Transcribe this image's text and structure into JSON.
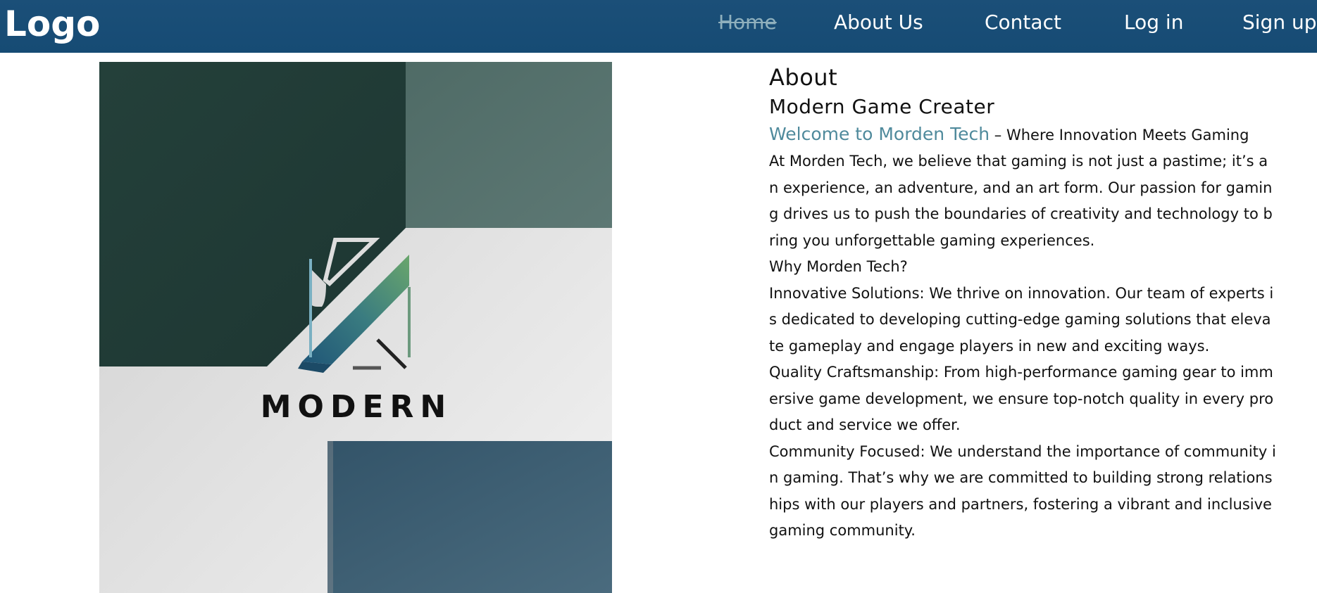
{
  "header": {
    "logo": "Logo",
    "nav": [
      {
        "label": "Home",
        "active": true
      },
      {
        "label": "About Us",
        "active": false
      },
      {
        "label": "Contact",
        "active": false
      },
      {
        "label": "Log in",
        "active": false
      },
      {
        "label": "Sign up",
        "active": false
      }
    ]
  },
  "hero": {
    "logo_text": "MODERN"
  },
  "about": {
    "title": "About",
    "subtitle": "Modern Game Creater",
    "welcome_accent": "Welcome to Morden Tech",
    "welcome_rest": " – Where Innovation Meets Gaming",
    "paragraphs": [
      "At Morden Tech, we believe that gaming is not just a pastime; it’s an experience, an adventure, and an art form. Our passion for gaming drives us to push the boundaries of creativity and technology to bring you unforgettable gaming experiences.",
      "Why Morden Tech?",
      "Innovative Solutions: We thrive on innovation. Our team of experts is dedicated to developing cutting-edge gaming solutions that elevate gameplay and engage players in new and exciting ways.",
      "Quality Craftsmanship: From high-performance gaming gear to immersive game development, we ensure top-notch quality in every product and service we offer.",
      "Community Focused: We understand the importance of community in gaming. That’s why we are committed to building strong relationships with our players and partners, fostering a vibrant and inclusive gaming community."
    ]
  },
  "colors": {
    "navbar": "#1b4f78",
    "accent": "#4f8a9c",
    "active_nav": "#8fb0bd"
  }
}
